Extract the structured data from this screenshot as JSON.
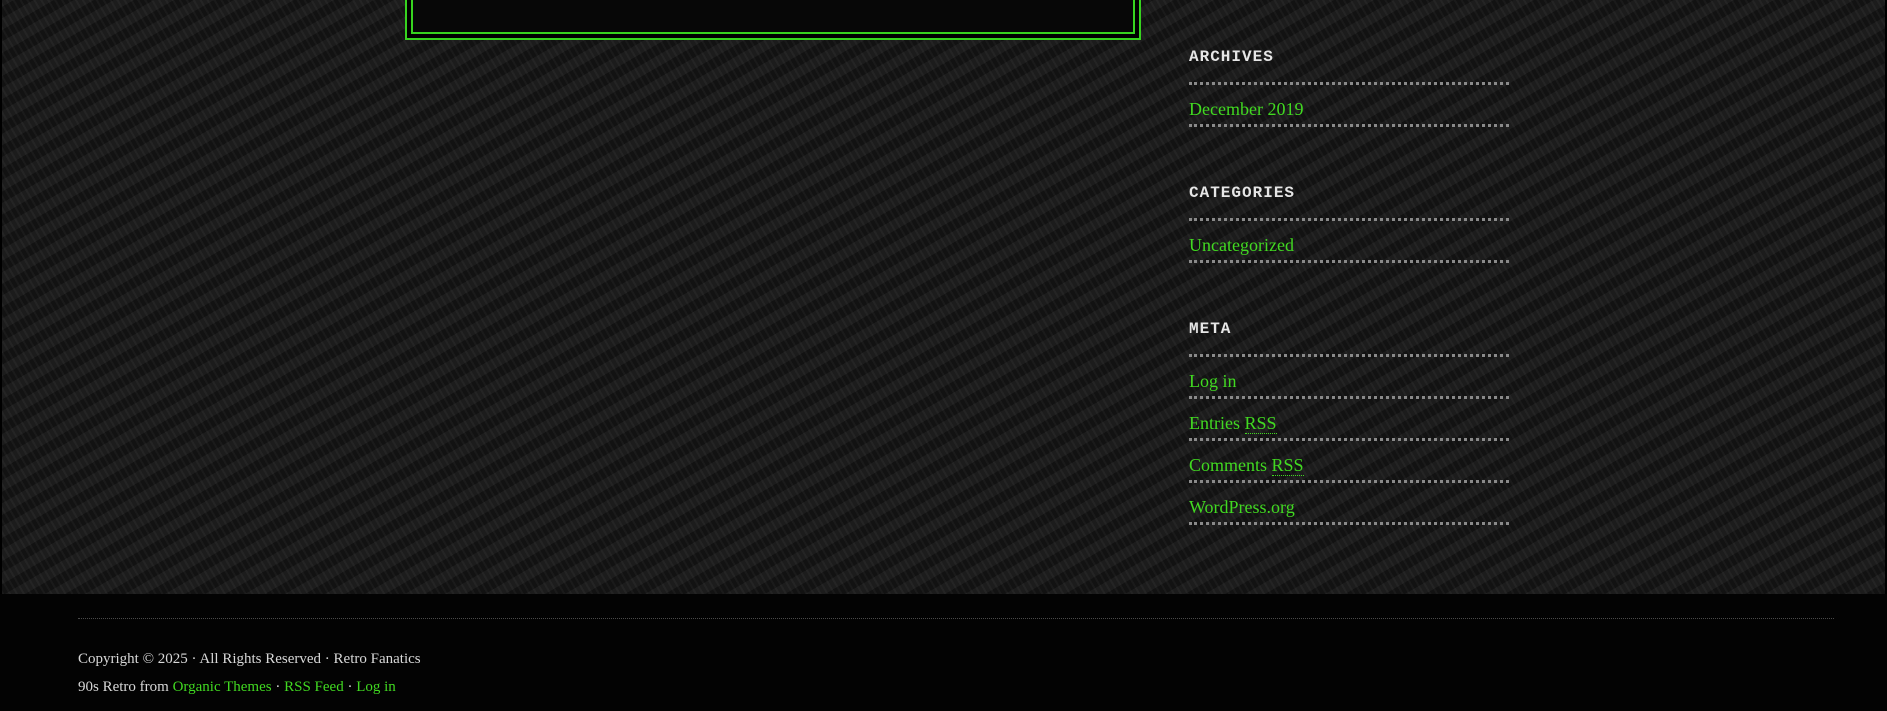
{
  "sidebar": {
    "archives": {
      "title": "ARCHIVES",
      "items": [
        "December 2019"
      ]
    },
    "categories": {
      "title": "CATEGORIES",
      "items": [
        "Uncategorized"
      ]
    },
    "meta": {
      "title": "META",
      "login": "Log in",
      "entries_prefix": "Entries",
      "entries_abbr": "RSS",
      "comments_prefix": "Comments",
      "comments_abbr": "RSS",
      "wordpress": "WordPress.org"
    }
  },
  "footer": {
    "copyright": "Copyright © 2025 · All Rights Reserved · Retro Fanatics",
    "theme_prefix": "90s Retro from",
    "organic_themes": "Organic Themes",
    "sep1": "·",
    "rss_feed": "RSS Feed",
    "sep2": "·",
    "login": "Log in"
  },
  "colors": {
    "accent": "#41d921",
    "background": "#1c1c1c",
    "footer_bg": "#030303"
  }
}
